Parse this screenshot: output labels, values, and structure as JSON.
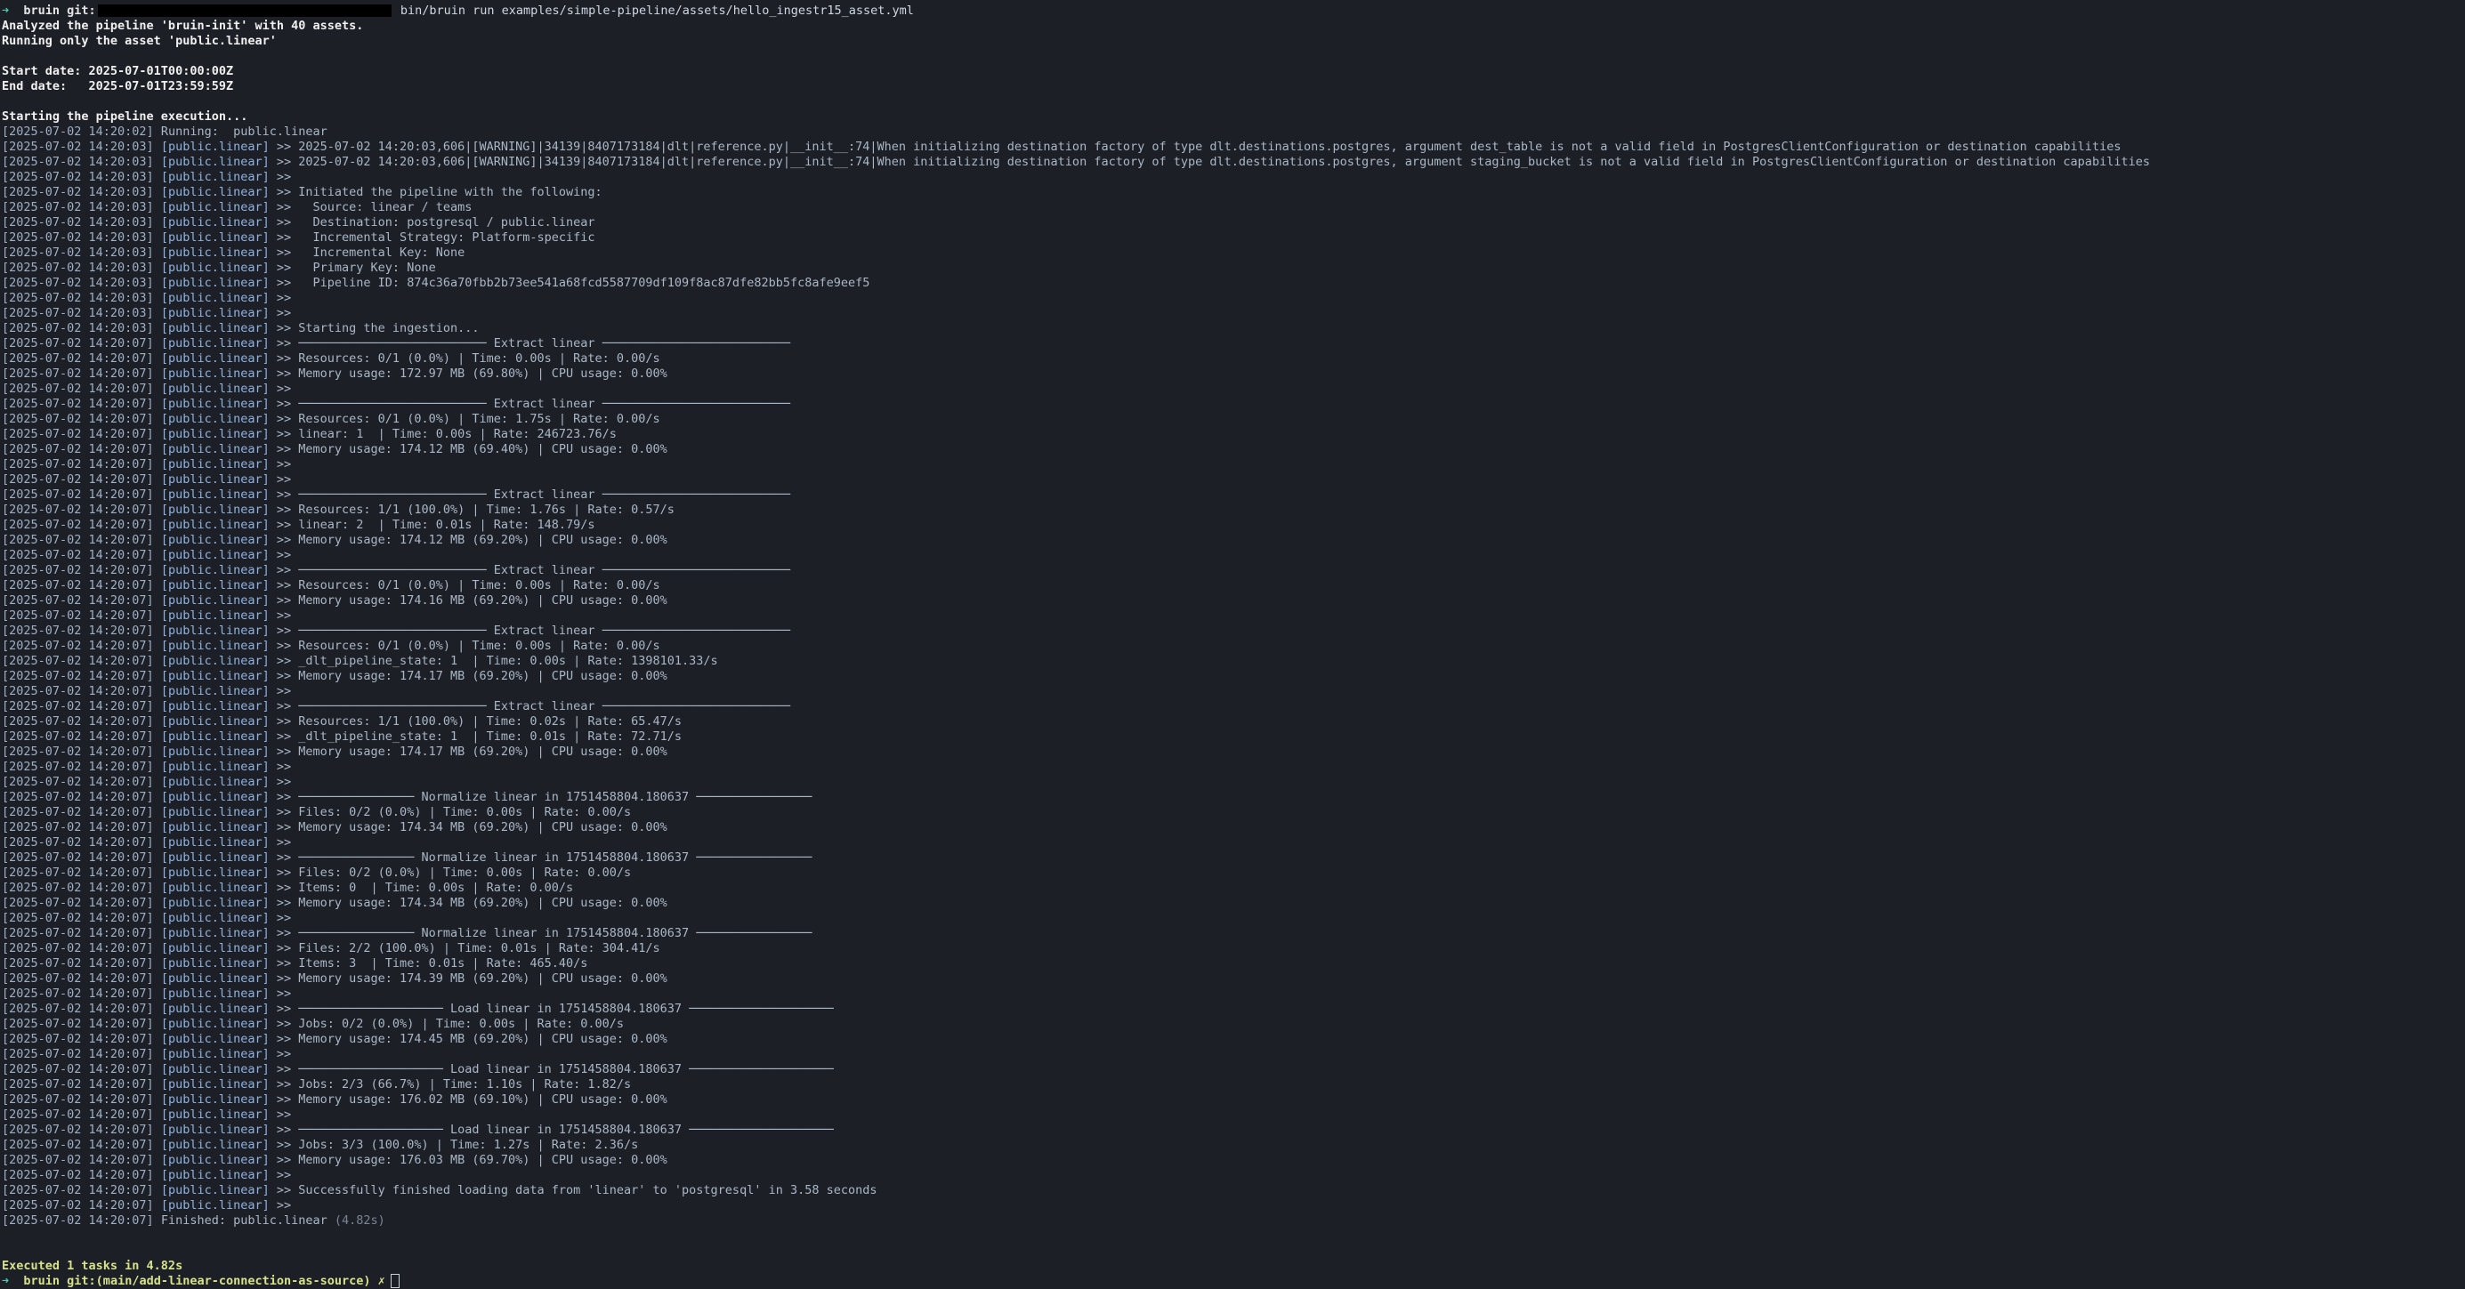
{
  "terminal": {
    "command": {
      "arrow": "➜",
      "repo": "bruin git:",
      "cmd": "bin/bruin run examples/simple-pipeline/assets/hello_ingestr15_asset.yml"
    },
    "header_lines": [
      "Analyzed the pipeline 'bruin-init' with 40 assets.",
      "Running only the asset 'public.linear'"
    ],
    "start_date": "Start date: 2025-07-01T00:00:00Z",
    "end_date": "End date:   2025-07-01T23:59:59Z",
    "starting": "Starting the pipeline execution...",
    "log": [
      {
        "ts": "[2025-07-02 14:20:02]",
        "asset": "",
        "msg": "Running:  public.linear"
      },
      {
        "ts": "[2025-07-02 14:20:03]",
        "asset": "[public.linear]",
        "msg": ">> 2025-07-02 14:20:03,606|[WARNING]|34139|8407173184|dlt|reference.py|__init__:74|When initializing destination factory of type dlt.destinations.postgres, argument dest_table is not a valid field in PostgresClientConfiguration or destination capabilities"
      },
      {
        "ts": "[2025-07-02 14:20:03]",
        "asset": "[public.linear]",
        "msg": ">> 2025-07-02 14:20:03,606|[WARNING]|34139|8407173184|dlt|reference.py|__init__:74|When initializing destination factory of type dlt.destinations.postgres, argument staging_bucket is not a valid field in PostgresClientConfiguration or destination capabilities"
      },
      {
        "ts": "[2025-07-02 14:20:03]",
        "asset": "[public.linear]",
        "msg": ">>"
      },
      {
        "ts": "[2025-07-02 14:20:03]",
        "asset": "[public.linear]",
        "msg": ">> Initiated the pipeline with the following:"
      },
      {
        "ts": "[2025-07-02 14:20:03]",
        "asset": "[public.linear]",
        "msg": ">>   Source: linear / teams"
      },
      {
        "ts": "[2025-07-02 14:20:03]",
        "asset": "[public.linear]",
        "msg": ">>   Destination: postgresql / public.linear"
      },
      {
        "ts": "[2025-07-02 14:20:03]",
        "asset": "[public.linear]",
        "msg": ">>   Incremental Strategy: Platform-specific"
      },
      {
        "ts": "[2025-07-02 14:20:03]",
        "asset": "[public.linear]",
        "msg": ">>   Incremental Key: None"
      },
      {
        "ts": "[2025-07-02 14:20:03]",
        "asset": "[public.linear]",
        "msg": ">>   Primary Key: None"
      },
      {
        "ts": "[2025-07-02 14:20:03]",
        "asset": "[public.linear]",
        "msg": ">>   Pipeline ID: 874c36a70fbb2b73ee541a68fcd5587709df109f8ac87dfe82bb5fc8afe9eef5"
      },
      {
        "ts": "[2025-07-02 14:20:03]",
        "asset": "[public.linear]",
        "msg": ">>"
      },
      {
        "ts": "[2025-07-02 14:20:03]",
        "asset": "[public.linear]",
        "msg": ">>"
      },
      {
        "ts": "[2025-07-02 14:20:03]",
        "asset": "[public.linear]",
        "msg": ">> Starting the ingestion..."
      },
      {
        "ts": "[2025-07-02 14:20:07]",
        "asset": "[public.linear]",
        "msg": ">> ────────────────────────── Extract linear ──────────────────────────"
      },
      {
        "ts": "[2025-07-02 14:20:07]",
        "asset": "[public.linear]",
        "msg": ">> Resources: 0/1 (0.0%) | Time: 0.00s | Rate: 0.00/s"
      },
      {
        "ts": "[2025-07-02 14:20:07]",
        "asset": "[public.linear]",
        "msg": ">> Memory usage: 172.97 MB (69.80%) | CPU usage: 0.00%"
      },
      {
        "ts": "[2025-07-02 14:20:07]",
        "asset": "[public.linear]",
        "msg": ">>"
      },
      {
        "ts": "[2025-07-02 14:20:07]",
        "asset": "[public.linear]",
        "msg": ">> ────────────────────────── Extract linear ──────────────────────────"
      },
      {
        "ts": "[2025-07-02 14:20:07]",
        "asset": "[public.linear]",
        "msg": ">> Resources: 0/1 (0.0%) | Time: 1.75s | Rate: 0.00/s"
      },
      {
        "ts": "[2025-07-02 14:20:07]",
        "asset": "[public.linear]",
        "msg": ">> linear: 1  | Time: 0.00s | Rate: 246723.76/s"
      },
      {
        "ts": "[2025-07-02 14:20:07]",
        "asset": "[public.linear]",
        "msg": ">> Memory usage: 174.12 MB (69.40%) | CPU usage: 0.00%"
      },
      {
        "ts": "[2025-07-02 14:20:07]",
        "asset": "[public.linear]",
        "msg": ">>"
      },
      {
        "ts": "[2025-07-02 14:20:07]",
        "asset": "[public.linear]",
        "msg": ">>"
      },
      {
        "ts": "[2025-07-02 14:20:07]",
        "asset": "[public.linear]",
        "msg": ">> ────────────────────────── Extract linear ──────────────────────────"
      },
      {
        "ts": "[2025-07-02 14:20:07]",
        "asset": "[public.linear]",
        "msg": ">> Resources: 1/1 (100.0%) | Time: 1.76s | Rate: 0.57/s"
      },
      {
        "ts": "[2025-07-02 14:20:07]",
        "asset": "[public.linear]",
        "msg": ">> linear: 2  | Time: 0.01s | Rate: 148.79/s"
      },
      {
        "ts": "[2025-07-02 14:20:07]",
        "asset": "[public.linear]",
        "msg": ">> Memory usage: 174.12 MB (69.20%) | CPU usage: 0.00%"
      },
      {
        "ts": "[2025-07-02 14:20:07]",
        "asset": "[public.linear]",
        "msg": ">>"
      },
      {
        "ts": "[2025-07-02 14:20:07]",
        "asset": "[public.linear]",
        "msg": ">> ────────────────────────── Extract linear ──────────────────────────"
      },
      {
        "ts": "[2025-07-02 14:20:07]",
        "asset": "[public.linear]",
        "msg": ">> Resources: 0/1 (0.0%) | Time: 0.00s | Rate: 0.00/s"
      },
      {
        "ts": "[2025-07-02 14:20:07]",
        "asset": "[public.linear]",
        "msg": ">> Memory usage: 174.16 MB (69.20%) | CPU usage: 0.00%"
      },
      {
        "ts": "[2025-07-02 14:20:07]",
        "asset": "[public.linear]",
        "msg": ">>"
      },
      {
        "ts": "[2025-07-02 14:20:07]",
        "asset": "[public.linear]",
        "msg": ">> ────────────────────────── Extract linear ──────────────────────────"
      },
      {
        "ts": "[2025-07-02 14:20:07]",
        "asset": "[public.linear]",
        "msg": ">> Resources: 0/1 (0.0%) | Time: 0.00s | Rate: 0.00/s"
      },
      {
        "ts": "[2025-07-02 14:20:07]",
        "asset": "[public.linear]",
        "msg": ">> _dlt_pipeline_state: 1  | Time: 0.00s | Rate: 1398101.33/s"
      },
      {
        "ts": "[2025-07-02 14:20:07]",
        "asset": "[public.linear]",
        "msg": ">> Memory usage: 174.17 MB (69.20%) | CPU usage: 0.00%"
      },
      {
        "ts": "[2025-07-02 14:20:07]",
        "asset": "[public.linear]",
        "msg": ">>"
      },
      {
        "ts": "[2025-07-02 14:20:07]",
        "asset": "[public.linear]",
        "msg": ">> ────────────────────────── Extract linear ──────────────────────────"
      },
      {
        "ts": "[2025-07-02 14:20:07]",
        "asset": "[public.linear]",
        "msg": ">> Resources: 1/1 (100.0%) | Time: 0.02s | Rate: 65.47/s"
      },
      {
        "ts": "[2025-07-02 14:20:07]",
        "asset": "[public.linear]",
        "msg": ">> _dlt_pipeline_state: 1  | Time: 0.01s | Rate: 72.71/s"
      },
      {
        "ts": "[2025-07-02 14:20:07]",
        "asset": "[public.linear]",
        "msg": ">> Memory usage: 174.17 MB (69.20%) | CPU usage: 0.00%"
      },
      {
        "ts": "[2025-07-02 14:20:07]",
        "asset": "[public.linear]",
        "msg": ">>"
      },
      {
        "ts": "[2025-07-02 14:20:07]",
        "asset": "[public.linear]",
        "msg": ">>"
      },
      {
        "ts": "[2025-07-02 14:20:07]",
        "asset": "[public.linear]",
        "msg": ">> ──────────────── Normalize linear in 1751458804.180637 ────────────────"
      },
      {
        "ts": "[2025-07-02 14:20:07]",
        "asset": "[public.linear]",
        "msg": ">> Files: 0/2 (0.0%) | Time: 0.00s | Rate: 0.00/s"
      },
      {
        "ts": "[2025-07-02 14:20:07]",
        "asset": "[public.linear]",
        "msg": ">> Memory usage: 174.34 MB (69.20%) | CPU usage: 0.00%"
      },
      {
        "ts": "[2025-07-02 14:20:07]",
        "asset": "[public.linear]",
        "msg": ">>"
      },
      {
        "ts": "[2025-07-02 14:20:07]",
        "asset": "[public.linear]",
        "msg": ">> ──────────────── Normalize linear in 1751458804.180637 ────────────────"
      },
      {
        "ts": "[2025-07-02 14:20:07]",
        "asset": "[public.linear]",
        "msg": ">> Files: 0/2 (0.0%) | Time: 0.00s | Rate: 0.00/s"
      },
      {
        "ts": "[2025-07-02 14:20:07]",
        "asset": "[public.linear]",
        "msg": ">> Items: 0  | Time: 0.00s | Rate: 0.00/s"
      },
      {
        "ts": "[2025-07-02 14:20:07]",
        "asset": "[public.linear]",
        "msg": ">> Memory usage: 174.34 MB (69.20%) | CPU usage: 0.00%"
      },
      {
        "ts": "[2025-07-02 14:20:07]",
        "asset": "[public.linear]",
        "msg": ">>"
      },
      {
        "ts": "[2025-07-02 14:20:07]",
        "asset": "[public.linear]",
        "msg": ">> ──────────────── Normalize linear in 1751458804.180637 ────────────────"
      },
      {
        "ts": "[2025-07-02 14:20:07]",
        "asset": "[public.linear]",
        "msg": ">> Files: 2/2 (100.0%) | Time: 0.01s | Rate: 304.41/s"
      },
      {
        "ts": "[2025-07-02 14:20:07]",
        "asset": "[public.linear]",
        "msg": ">> Items: 3  | Time: 0.01s | Rate: 465.40/s"
      },
      {
        "ts": "[2025-07-02 14:20:07]",
        "asset": "[public.linear]",
        "msg": ">> Memory usage: 174.39 MB (69.20%) | CPU usage: 0.00%"
      },
      {
        "ts": "[2025-07-02 14:20:07]",
        "asset": "[public.linear]",
        "msg": ">>"
      },
      {
        "ts": "[2025-07-02 14:20:07]",
        "asset": "[public.linear]",
        "msg": ">> ──────────────────── Load linear in 1751458804.180637 ────────────────────"
      },
      {
        "ts": "[2025-07-02 14:20:07]",
        "asset": "[public.linear]",
        "msg": ">> Jobs: 0/2 (0.0%) | Time: 0.00s | Rate: 0.00/s"
      },
      {
        "ts": "[2025-07-02 14:20:07]",
        "asset": "[public.linear]",
        "msg": ">> Memory usage: 174.45 MB (69.20%) | CPU usage: 0.00%"
      },
      {
        "ts": "[2025-07-02 14:20:07]",
        "asset": "[public.linear]",
        "msg": ">>"
      },
      {
        "ts": "[2025-07-02 14:20:07]",
        "asset": "[public.linear]",
        "msg": ">> ──────────────────── Load linear in 1751458804.180637 ────────────────────"
      },
      {
        "ts": "[2025-07-02 14:20:07]",
        "asset": "[public.linear]",
        "msg": ">> Jobs: 2/3 (66.7%) | Time: 1.10s | Rate: 1.82/s"
      },
      {
        "ts": "[2025-07-02 14:20:07]",
        "asset": "[public.linear]",
        "msg": ">> Memory usage: 176.02 MB (69.10%) | CPU usage: 0.00%"
      },
      {
        "ts": "[2025-07-02 14:20:07]",
        "asset": "[public.linear]",
        "msg": ">>"
      },
      {
        "ts": "[2025-07-02 14:20:07]",
        "asset": "[public.linear]",
        "msg": ">> ──────────────────── Load linear in 1751458804.180637 ────────────────────"
      },
      {
        "ts": "[2025-07-02 14:20:07]",
        "asset": "[public.linear]",
        "msg": ">> Jobs: 3/3 (100.0%) | Time: 1.27s | Rate: 2.36/s"
      },
      {
        "ts": "[2025-07-02 14:20:07]",
        "asset": "[public.linear]",
        "msg": ">> Memory usage: 176.03 MB (69.70%) | CPU usage: 0.00%"
      },
      {
        "ts": "[2025-07-02 14:20:07]",
        "asset": "[public.linear]",
        "msg": ">>"
      },
      {
        "ts": "[2025-07-02 14:20:07]",
        "asset": "[public.linear]",
        "msg": ">> Successfully finished loading data from 'linear' to 'postgresql' in 3.58 seconds"
      },
      {
        "ts": "[2025-07-02 14:20:07]",
        "asset": "[public.linear]",
        "msg": ">>"
      }
    ],
    "finished": {
      "ts": "[2025-07-02 14:20:07]",
      "label": "Finished: public.linear",
      "duration": "(4.82s)"
    },
    "summary": "Executed 1 tasks in 4.82s",
    "next_prompt": "bruin git:(main/add-linear-connection-as-source) ✗"
  },
  "colors": {
    "background": "#1d1f26",
    "accent_green": "#d6e28a",
    "prompt_arrow": "#4ec9b0"
  }
}
